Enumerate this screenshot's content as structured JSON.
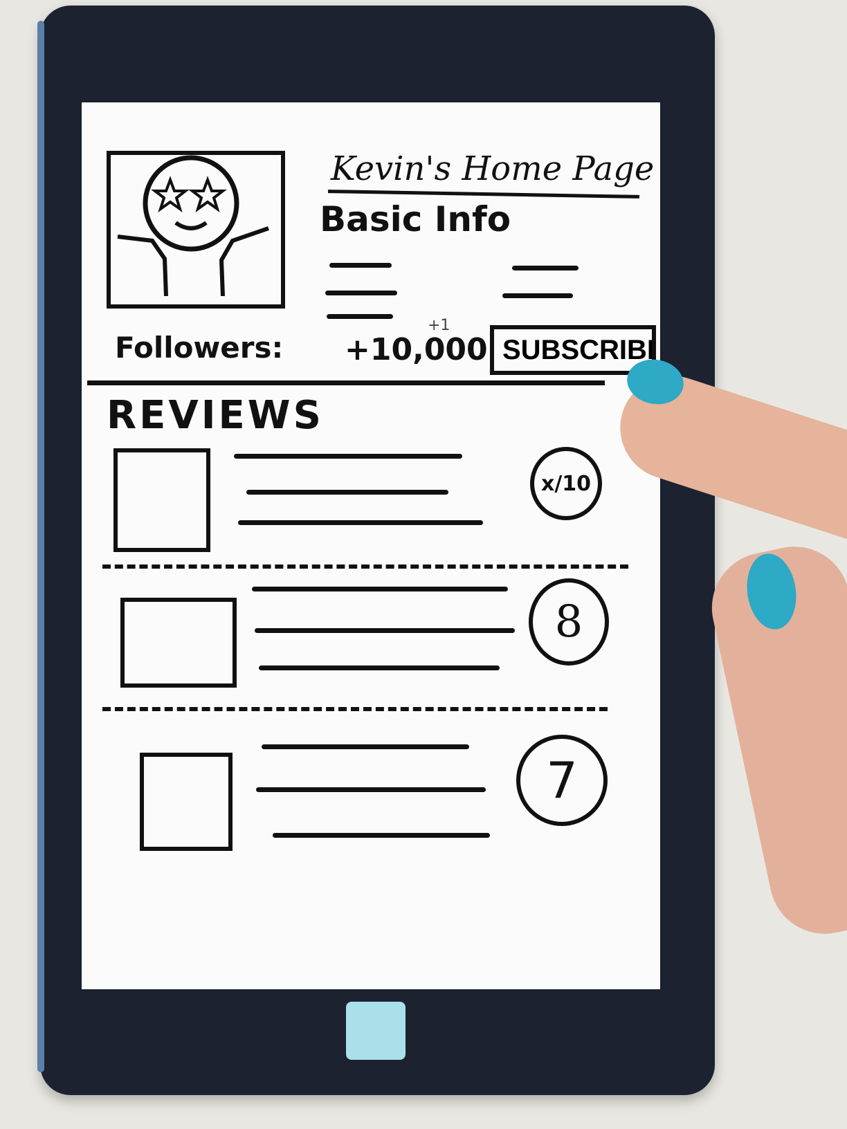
{
  "app": {
    "title": "Kevin's Home Page"
  },
  "profile": {
    "section_label": "Basic Info",
    "followers_label": "Followers:",
    "followers_count": "+10,000",
    "increment": "+1",
    "subscribe_label": "SUBSCRIBE"
  },
  "reviews": {
    "heading": "REVIEWS",
    "items": [
      {
        "score_label": "x/10"
      },
      {
        "score_label": "8"
      },
      {
        "score_label": "7"
      }
    ]
  },
  "colors": {
    "device": "#1c2230",
    "screen": "#fbfbfb",
    "ink": "#111111",
    "home_button": "#a9e0ea",
    "nail": "#2ea9c6"
  }
}
